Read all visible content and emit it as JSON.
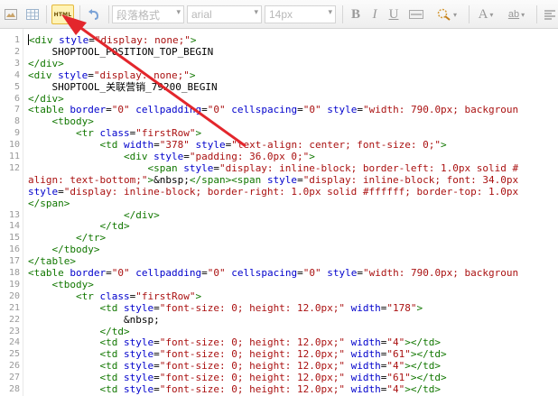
{
  "toolbar": {
    "html_button_label": "HTML",
    "paragraph_format": "段落格式",
    "font_family": "arial",
    "font_size": "14px",
    "bold_label": "B",
    "italic_label": "I",
    "underline_label": "U",
    "font_color_label": "A",
    "highlight_label": "ab"
  },
  "colors": {
    "arrow": "#e3262c",
    "tag": "#117700",
    "attr": "#0000cc",
    "value": "#aa1111",
    "text": "#000000"
  },
  "code_lines": [
    {
      "n": "1",
      "html": "<span class=\"t\">&lt;div</span> <span class=\"a\">style</span>=<span class=\"v\">\"display: none;\"</span><span class=\"t\">&gt;</span>"
    },
    {
      "n": "2",
      "html": "    SHOPTOOL_POSITION_TOP_BEGIN"
    },
    {
      "n": "3",
      "html": "<span class=\"t\">&lt;/div&gt;</span>"
    },
    {
      "n": "4",
      "html": "<span class=\"t\">&lt;div</span> <span class=\"a\">style</span>=<span class=\"v\">\"display: none;\"</span><span class=\"t\">&gt;</span>"
    },
    {
      "n": "5",
      "html": "    SHOPTOOL_关联营销_79200_BEGIN"
    },
    {
      "n": "6",
      "html": "<span class=\"t\">&lt;/div&gt;</span>"
    },
    {
      "n": "7",
      "html": "<span class=\"t\">&lt;table</span> <span class=\"a\">border</span>=<span class=\"v\">\"0\"</span> <span class=\"a\">cellpadding</span>=<span class=\"v\">\"0\"</span> <span class=\"a\">cellspacing</span>=<span class=\"v\">\"0\"</span> <span class=\"a\">style</span>=<span class=\"v\">\"width: 790.0px; backgroun</span>"
    },
    {
      "n": "8",
      "html": "    <span class=\"t\">&lt;tbody&gt;</span>"
    },
    {
      "n": "9",
      "html": "        <span class=\"t\">&lt;tr</span> <span class=\"a\">class</span>=<span class=\"v\">\"firstRow\"</span><span class=\"t\">&gt;</span>"
    },
    {
      "n": "10",
      "html": "            <span class=\"t\">&lt;td</span> <span class=\"a\">width</span>=<span class=\"v\">\"378\"</span> <span class=\"a\">style</span>=<span class=\"v\">\"text-align: center; font-size: 0;\"</span><span class=\"t\">&gt;</span>"
    },
    {
      "n": "11",
      "html": "                <span class=\"t\">&lt;div</span> <span class=\"a\">style</span>=<span class=\"v\">\"padding: 36.0px 0;\"</span><span class=\"t\">&gt;</span>"
    },
    {
      "n": "12",
      "html": "                    <span class=\"t\">&lt;span</span> <span class=\"a\">style</span>=<span class=\"v\">\"display: inline-block; border-left: 1.0px solid #</span>"
    },
    {
      "n": "",
      "html": "<span class=\"v\">align: text-bottom;\"</span><span class=\"t\">&gt;</span>&amp;nbsp;<span class=\"t\">&lt;/span&gt;&lt;span</span> <span class=\"a\">style</span>=<span class=\"v\">\"display: inline-block; font: 34.0px</span>"
    },
    {
      "n": "",
      "html": "<span class=\"a\">style</span>=<span class=\"v\">\"display: inline-block; border-right: 1.0px solid #ffffff; border-top: 1.0px</span>"
    },
    {
      "n": "",
      "html": "<span class=\"t\">&lt;/span&gt;</span>"
    },
    {
      "n": "13",
      "html": "                <span class=\"t\">&lt;/div&gt;</span>"
    },
    {
      "n": "14",
      "html": "            <span class=\"t\">&lt;/td&gt;</span>"
    },
    {
      "n": "15",
      "html": "        <span class=\"t\">&lt;/tr&gt;</span>"
    },
    {
      "n": "16",
      "html": "    <span class=\"t\">&lt;/tbody&gt;</span>"
    },
    {
      "n": "17",
      "html": "<span class=\"t\">&lt;/table&gt;</span>"
    },
    {
      "n": "18",
      "html": "<span class=\"t\">&lt;table</span> <span class=\"a\">border</span>=<span class=\"v\">\"0\"</span> <span class=\"a\">cellpadding</span>=<span class=\"v\">\"0\"</span> <span class=\"a\">cellspacing</span>=<span class=\"v\">\"0\"</span> <span class=\"a\">style</span>=<span class=\"v\">\"width: 790.0px; backgroun</span>"
    },
    {
      "n": "19",
      "html": "    <span class=\"t\">&lt;tbody&gt;</span>"
    },
    {
      "n": "20",
      "html": "        <span class=\"t\">&lt;tr</span> <span class=\"a\">class</span>=<span class=\"v\">\"firstRow\"</span><span class=\"t\">&gt;</span>"
    },
    {
      "n": "21",
      "html": "            <span class=\"t\">&lt;td</span> <span class=\"a\">style</span>=<span class=\"v\">\"font-size: 0; height: 12.0px;\"</span> <span class=\"a\">width</span>=<span class=\"v\">\"178\"</span><span class=\"t\">&gt;</span>"
    },
    {
      "n": "22",
      "html": "                &amp;nbsp;"
    },
    {
      "n": "23",
      "html": "            <span class=\"t\">&lt;/td&gt;</span>"
    },
    {
      "n": "24",
      "html": "            <span class=\"t\">&lt;td</span> <span class=\"a\">style</span>=<span class=\"v\">\"font-size: 0; height: 12.0px;\"</span> <span class=\"a\">width</span>=<span class=\"v\">\"4\"</span><span class=\"t\">&gt;&lt;/td&gt;</span>"
    },
    {
      "n": "25",
      "html": "            <span class=\"t\">&lt;td</span> <span class=\"a\">style</span>=<span class=\"v\">\"font-size: 0; height: 12.0px;\"</span> <span class=\"a\">width</span>=<span class=\"v\">\"61\"</span><span class=\"t\">&gt;&lt;/td&gt;</span>"
    },
    {
      "n": "26",
      "html": "            <span class=\"t\">&lt;td</span> <span class=\"a\">style</span>=<span class=\"v\">\"font-size: 0; height: 12.0px;\"</span> <span class=\"a\">width</span>=<span class=\"v\">\"4\"</span><span class=\"t\">&gt;&lt;/td&gt;</span>"
    },
    {
      "n": "27",
      "html": "            <span class=\"t\">&lt;td</span> <span class=\"a\">style</span>=<span class=\"v\">\"font-size: 0; height: 12.0px;\"</span> <span class=\"a\">width</span>=<span class=\"v\">\"61\"</span><span class=\"t\">&gt;&lt;/td&gt;</span>"
    },
    {
      "n": "28",
      "html": "            <span class=\"t\">&lt;td</span> <span class=\"a\">style</span>=<span class=\"v\">\"font-size: 0; height: 12.0px;\"</span> <span class=\"a\">width</span>=<span class=\"v\">\"4\"</span><span class=\"t\">&gt;&lt;/td&gt;</span>"
    }
  ]
}
